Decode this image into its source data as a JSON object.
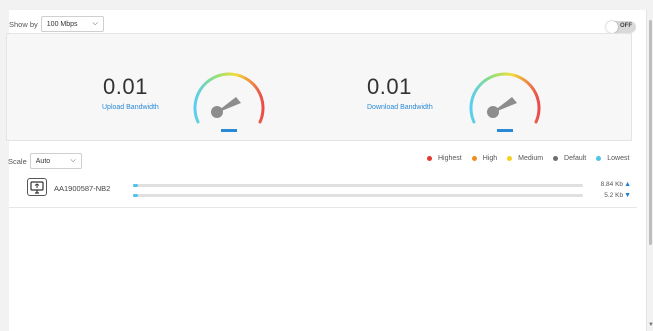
{
  "controls": {
    "show_by_label": "Show by",
    "show_by_value": "100 Mbps",
    "toggle_label": "OFF",
    "scale_label": "Scale",
    "scale_value": "Auto"
  },
  "upload": {
    "value": "0.01",
    "label": "Upload Bandwidth"
  },
  "download": {
    "value": "0.01",
    "label": "Download Bandwidth"
  },
  "legend": [
    {
      "label": "Highest",
      "color": "#e53935"
    },
    {
      "label": "High",
      "color": "#f58a1f"
    },
    {
      "label": "Medium",
      "color": "#f4d21c"
    },
    {
      "label": "Default",
      "color": "#6d6d6d"
    },
    {
      "label": "Lowest",
      "color": "#4dc4ec"
    }
  ],
  "devices": [
    {
      "name": "AA1900587-NB2",
      "up_rate": "8.84 Kb",
      "down_rate": "5.2 Kb",
      "up_fill": 0.01,
      "down_fill": 0.01
    }
  ],
  "colors": {
    "accent": "#2a8ad8",
    "gauge_needle": "#8d8d8d"
  }
}
